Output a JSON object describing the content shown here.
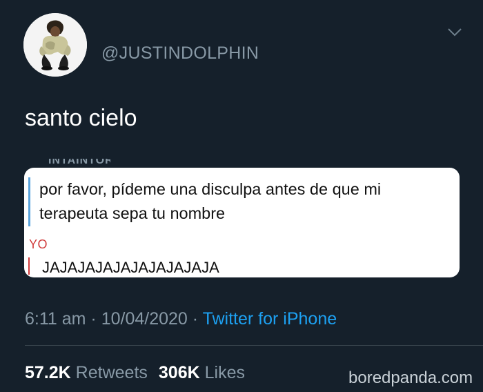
{
  "tweet": {
    "handle": "@JUSTINDOLPHIN",
    "text": "santo cielo",
    "avatar_icon": "person-crouching-avatar",
    "menu_icon": "chevron-down-icon"
  },
  "embedded_chat": {
    "cut_off_label": "INTAINTOR",
    "quoted_message": "por favor, pídeme una disculpa antes de que mi terapeuta sepa tu nombre",
    "reply_author": "YO",
    "reply_message": "JAJAJAJAJAJAJAJAJAJA",
    "quote_color": "#5ba4dc",
    "reply_color": "#d03b3b"
  },
  "meta": {
    "time": "6:11 am",
    "separator1": " · ",
    "date": "10/04/2020",
    "separator2": " · ",
    "source": "Twitter for iPhone"
  },
  "stats": {
    "retweets_count": "57.2K",
    "retweets_label": "Retweets",
    "likes_count": "306K",
    "likes_label": "Likes"
  },
  "watermark": "boredpanda.com",
  "colors": {
    "background": "#15202b",
    "link": "#1da1f2",
    "muted": "#8899a6"
  }
}
